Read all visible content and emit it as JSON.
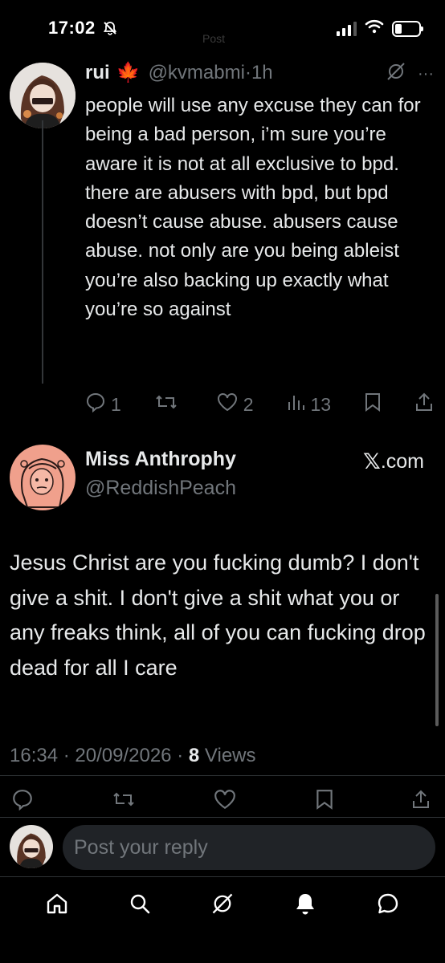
{
  "status_bar": {
    "time": "17:02",
    "ghost_title": "Post",
    "icons": [
      "bell-slash-icon",
      "signal-icon",
      "wifi-icon",
      "battery-icon"
    ],
    "battery_level": 0.3
  },
  "reply_tweet": {
    "display_name": "rui",
    "emoji": "🍁",
    "handle": "@kvmabmi",
    "separator": "·",
    "time_ago": "1h",
    "text": "people will use any excuse they can for being a bad person, i’m sure you’re aware it is not at all exclusive to bpd. there are abusers with bpd, but bpd doesn’t cause abuse. abusers cause abuse. not only are you being ableist you’re also backing up exactly what you’re so against",
    "more_label": "···",
    "stats": {
      "replies": "1",
      "reposts": "",
      "likes": "2",
      "views": "13"
    }
  },
  "main_tweet": {
    "display_name": "Miss Anthrophy",
    "handle": "@ReddishPeach",
    "source_x": "𝕏",
    "source_domain": ".com",
    "text": "Jesus Christ are you fucking dumb? I don't give a shit. I don't give a shit what you or any freaks think, all of you can fucking drop dead for all I care",
    "time": "16:34",
    "date": "20/09/2026",
    "separator": "·",
    "view_count": "8",
    "views_label": "Views"
  },
  "composer": {
    "placeholder": "Post your reply"
  },
  "nav": [
    "home-icon",
    "search-icon",
    "grok-icon",
    "notifications-icon",
    "messages-icon"
  ],
  "colors": {
    "background": "#000000",
    "text": "#e7e9ea",
    "muted": "#71767b",
    "divider": "#2f3336",
    "reply_field": "#202327",
    "avatar_peach": "#f0a08c"
  }
}
